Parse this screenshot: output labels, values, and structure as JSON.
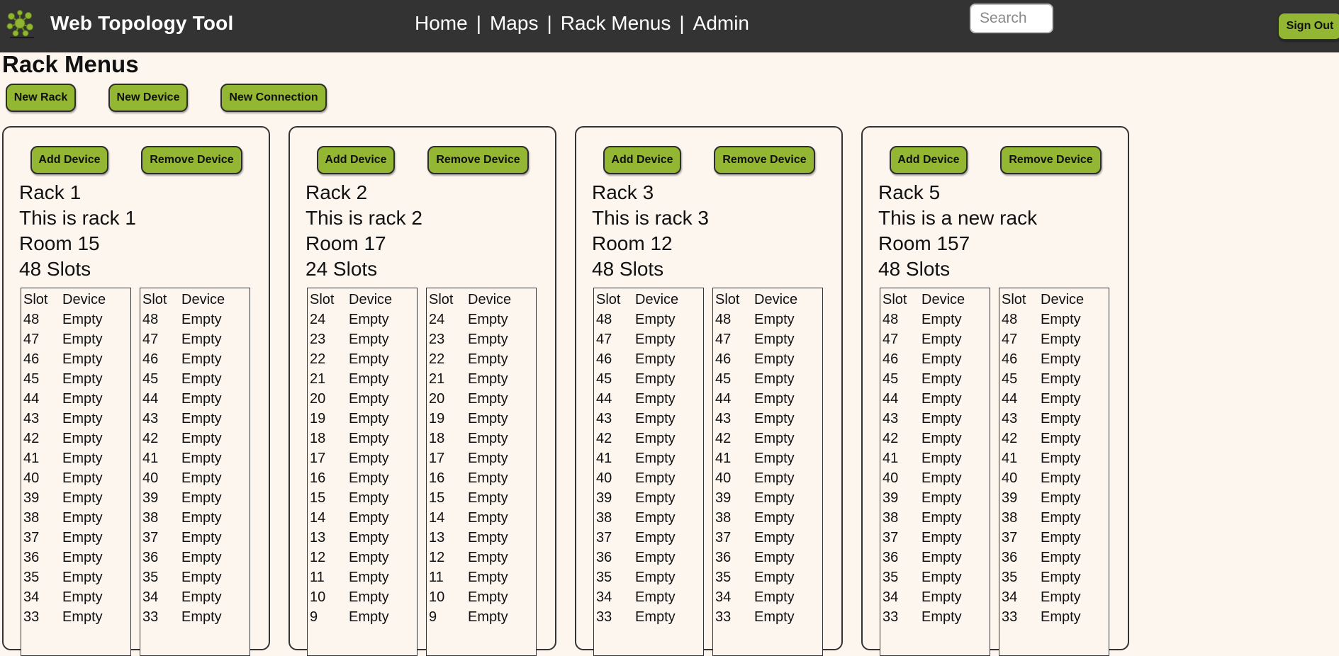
{
  "header": {
    "app_title": "Web Topology Tool",
    "logo_icon": "cluster-network-logo-icon",
    "nav": [
      "Home",
      "Maps",
      "Rack Menus",
      "Admin"
    ],
    "nav_separator": "|",
    "search_placeholder": "Search",
    "sign_out_label": "Sign Out"
  },
  "page": {
    "title": "Rack Menus",
    "actions": [
      "New Rack",
      "New Device",
      "New Connection"
    ]
  },
  "rack_card_buttons": {
    "add": "Add Device",
    "remove": "Remove Device"
  },
  "table_headers": {
    "slot": "Slot",
    "device": "Device"
  },
  "racks": [
    {
      "name": "Rack 1",
      "description": "This is rack 1",
      "room": "Room 15",
      "slots_label": "48 Slots",
      "tables": [
        [
          [
            "48",
            "Empty"
          ],
          [
            "47",
            "Empty"
          ],
          [
            "46",
            "Empty"
          ],
          [
            "45",
            "Empty"
          ],
          [
            "44",
            "Empty"
          ],
          [
            "43",
            "Empty"
          ],
          [
            "42",
            "Empty"
          ],
          [
            "41",
            "Empty"
          ],
          [
            "40",
            "Empty"
          ],
          [
            "39",
            "Empty"
          ],
          [
            "38",
            "Empty"
          ],
          [
            "37",
            "Empty"
          ],
          [
            "36",
            "Empty"
          ],
          [
            "35",
            "Empty"
          ],
          [
            "34",
            "Empty"
          ],
          [
            "33",
            "Empty"
          ]
        ],
        [
          [
            "48",
            "Empty"
          ],
          [
            "47",
            "Empty"
          ],
          [
            "46",
            "Empty"
          ],
          [
            "45",
            "Empty"
          ],
          [
            "44",
            "Empty"
          ],
          [
            "43",
            "Empty"
          ],
          [
            "42",
            "Empty"
          ],
          [
            "41",
            "Empty"
          ],
          [
            "40",
            "Empty"
          ],
          [
            "39",
            "Empty"
          ],
          [
            "38",
            "Empty"
          ],
          [
            "37",
            "Empty"
          ],
          [
            "36",
            "Empty"
          ],
          [
            "35",
            "Empty"
          ],
          [
            "34",
            "Empty"
          ],
          [
            "33",
            "Empty"
          ]
        ]
      ]
    },
    {
      "name": "Rack 2",
      "description": "This is rack 2",
      "room": "Room 17",
      "slots_label": "24 Slots",
      "tables": [
        [
          [
            "24",
            "Empty"
          ],
          [
            "23",
            "Empty"
          ],
          [
            "22",
            "Empty"
          ],
          [
            "21",
            "Empty"
          ],
          [
            "20",
            "Empty"
          ],
          [
            "19",
            "Empty"
          ],
          [
            "18",
            "Empty"
          ],
          [
            "17",
            "Empty"
          ],
          [
            "16",
            "Empty"
          ],
          [
            "15",
            "Empty"
          ],
          [
            "14",
            "Empty"
          ],
          [
            "13",
            "Empty"
          ],
          [
            "12",
            "Empty"
          ],
          [
            "11",
            "Empty"
          ],
          [
            "10",
            "Empty"
          ],
          [
            "9",
            "Empty"
          ]
        ],
        [
          [
            "24",
            "Empty"
          ],
          [
            "23",
            "Empty"
          ],
          [
            "22",
            "Empty"
          ],
          [
            "21",
            "Empty"
          ],
          [
            "20",
            "Empty"
          ],
          [
            "19",
            "Empty"
          ],
          [
            "18",
            "Empty"
          ],
          [
            "17",
            "Empty"
          ],
          [
            "16",
            "Empty"
          ],
          [
            "15",
            "Empty"
          ],
          [
            "14",
            "Empty"
          ],
          [
            "13",
            "Empty"
          ],
          [
            "12",
            "Empty"
          ],
          [
            "11",
            "Empty"
          ],
          [
            "10",
            "Empty"
          ],
          [
            "9",
            "Empty"
          ]
        ]
      ]
    },
    {
      "name": "Rack 3",
      "description": "This is rack 3",
      "room": "Room 12",
      "slots_label": "48 Slots",
      "tables": [
        [
          [
            "48",
            "Empty"
          ],
          [
            "47",
            "Empty"
          ],
          [
            "46",
            "Empty"
          ],
          [
            "45",
            "Empty"
          ],
          [
            "44",
            "Empty"
          ],
          [
            "43",
            "Empty"
          ],
          [
            "42",
            "Empty"
          ],
          [
            "41",
            "Empty"
          ],
          [
            "40",
            "Empty"
          ],
          [
            "39",
            "Empty"
          ],
          [
            "38",
            "Empty"
          ],
          [
            "37",
            "Empty"
          ],
          [
            "36",
            "Empty"
          ],
          [
            "35",
            "Empty"
          ],
          [
            "34",
            "Empty"
          ],
          [
            "33",
            "Empty"
          ]
        ],
        [
          [
            "48",
            "Empty"
          ],
          [
            "47",
            "Empty"
          ],
          [
            "46",
            "Empty"
          ],
          [
            "45",
            "Empty"
          ],
          [
            "44",
            "Empty"
          ],
          [
            "43",
            "Empty"
          ],
          [
            "42",
            "Empty"
          ],
          [
            "41",
            "Empty"
          ],
          [
            "40",
            "Empty"
          ],
          [
            "39",
            "Empty"
          ],
          [
            "38",
            "Empty"
          ],
          [
            "37",
            "Empty"
          ],
          [
            "36",
            "Empty"
          ],
          [
            "35",
            "Empty"
          ],
          [
            "34",
            "Empty"
          ],
          [
            "33",
            "Empty"
          ]
        ]
      ]
    },
    {
      "name": "Rack 5",
      "description": "This is a new rack",
      "room": "Room 157",
      "slots_label": "48 Slots",
      "tables": [
        [
          [
            "48",
            "Empty"
          ],
          [
            "47",
            "Empty"
          ],
          [
            "46",
            "Empty"
          ],
          [
            "45",
            "Empty"
          ],
          [
            "44",
            "Empty"
          ],
          [
            "43",
            "Empty"
          ],
          [
            "42",
            "Empty"
          ],
          [
            "41",
            "Empty"
          ],
          [
            "40",
            "Empty"
          ],
          [
            "39",
            "Empty"
          ],
          [
            "38",
            "Empty"
          ],
          [
            "37",
            "Empty"
          ],
          [
            "36",
            "Empty"
          ],
          [
            "35",
            "Empty"
          ],
          [
            "34",
            "Empty"
          ],
          [
            "33",
            "Empty"
          ]
        ],
        [
          [
            "48",
            "Empty"
          ],
          [
            "47",
            "Empty"
          ],
          [
            "46",
            "Empty"
          ],
          [
            "45",
            "Empty"
          ],
          [
            "44",
            "Empty"
          ],
          [
            "43",
            "Empty"
          ],
          [
            "42",
            "Empty"
          ],
          [
            "41",
            "Empty"
          ],
          [
            "40",
            "Empty"
          ],
          [
            "39",
            "Empty"
          ],
          [
            "38",
            "Empty"
          ],
          [
            "37",
            "Empty"
          ],
          [
            "36",
            "Empty"
          ],
          [
            "35",
            "Empty"
          ],
          [
            "34",
            "Empty"
          ],
          [
            "33",
            "Empty"
          ]
        ]
      ]
    }
  ],
  "colors": {
    "header_bg": "#333333",
    "page_bg": "#fdf6ef",
    "button_green": "#93b732",
    "logo_green": "#8fb531"
  }
}
